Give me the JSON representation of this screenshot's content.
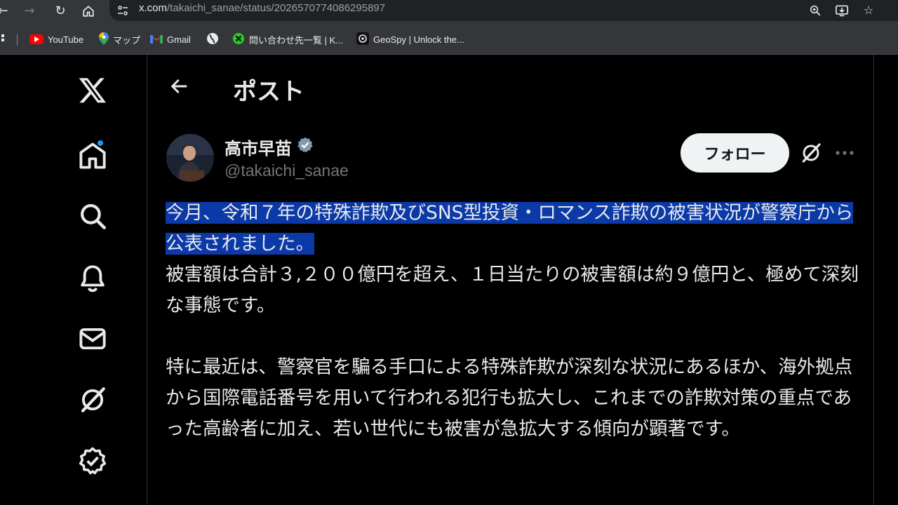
{
  "browser": {
    "url_domain": "x.com",
    "url_path": "/takaichi_sanae/status/2026570774086295897",
    "bookmarks": [
      {
        "label": "YouTube",
        "icon": "youtube-icon",
        "color": "#ff0000"
      },
      {
        "label": "マップ",
        "icon": "maps-icon",
        "color": "#34a853"
      },
      {
        "label": "Gmail",
        "icon": "gmail-icon",
        "color": "#ea4335"
      },
      {
        "label": "",
        "icon": "globe-icon",
        "color": "#e8eaed"
      },
      {
        "label": "問い合わせ先一覧 | K...",
        "icon": "green-x-icon",
        "color": "#21d120"
      },
      {
        "label": "GeoSpy | Unlock the...",
        "icon": "geospy-icon",
        "color": "#1a1a1a"
      }
    ]
  },
  "header": {
    "title": "ポスト"
  },
  "post": {
    "author_name": "高市早苗",
    "author_handle": "@takaichi_sanae",
    "verified": true,
    "follow_label": "フォロー",
    "highlighted_text": "今月、令和７年の特殊詐欺及びSNS型投資・ロマンス詐欺の被害状況が警察庁から公表されました。",
    "paragraph1_rest": "被害額は合計３,２００億円を超え、１日当たりの被害額は約９億円と、極めて深刻な事態です。",
    "paragraph2": "特に最近は、警察官を騙る手口による特殊詐欺が深刻な状況にあるほか、海外拠点から国際電話番号を用いて行われる犯行も拡大し、これまでの詐欺対策の重点であった高齢者に加え、若い世代にも被害が急拡大する傾向が顕著です。"
  },
  "colors": {
    "accent": "#1d9bf0",
    "highlight": "#0b3aa8",
    "background": "#000000",
    "muted_text": "#71767b"
  }
}
